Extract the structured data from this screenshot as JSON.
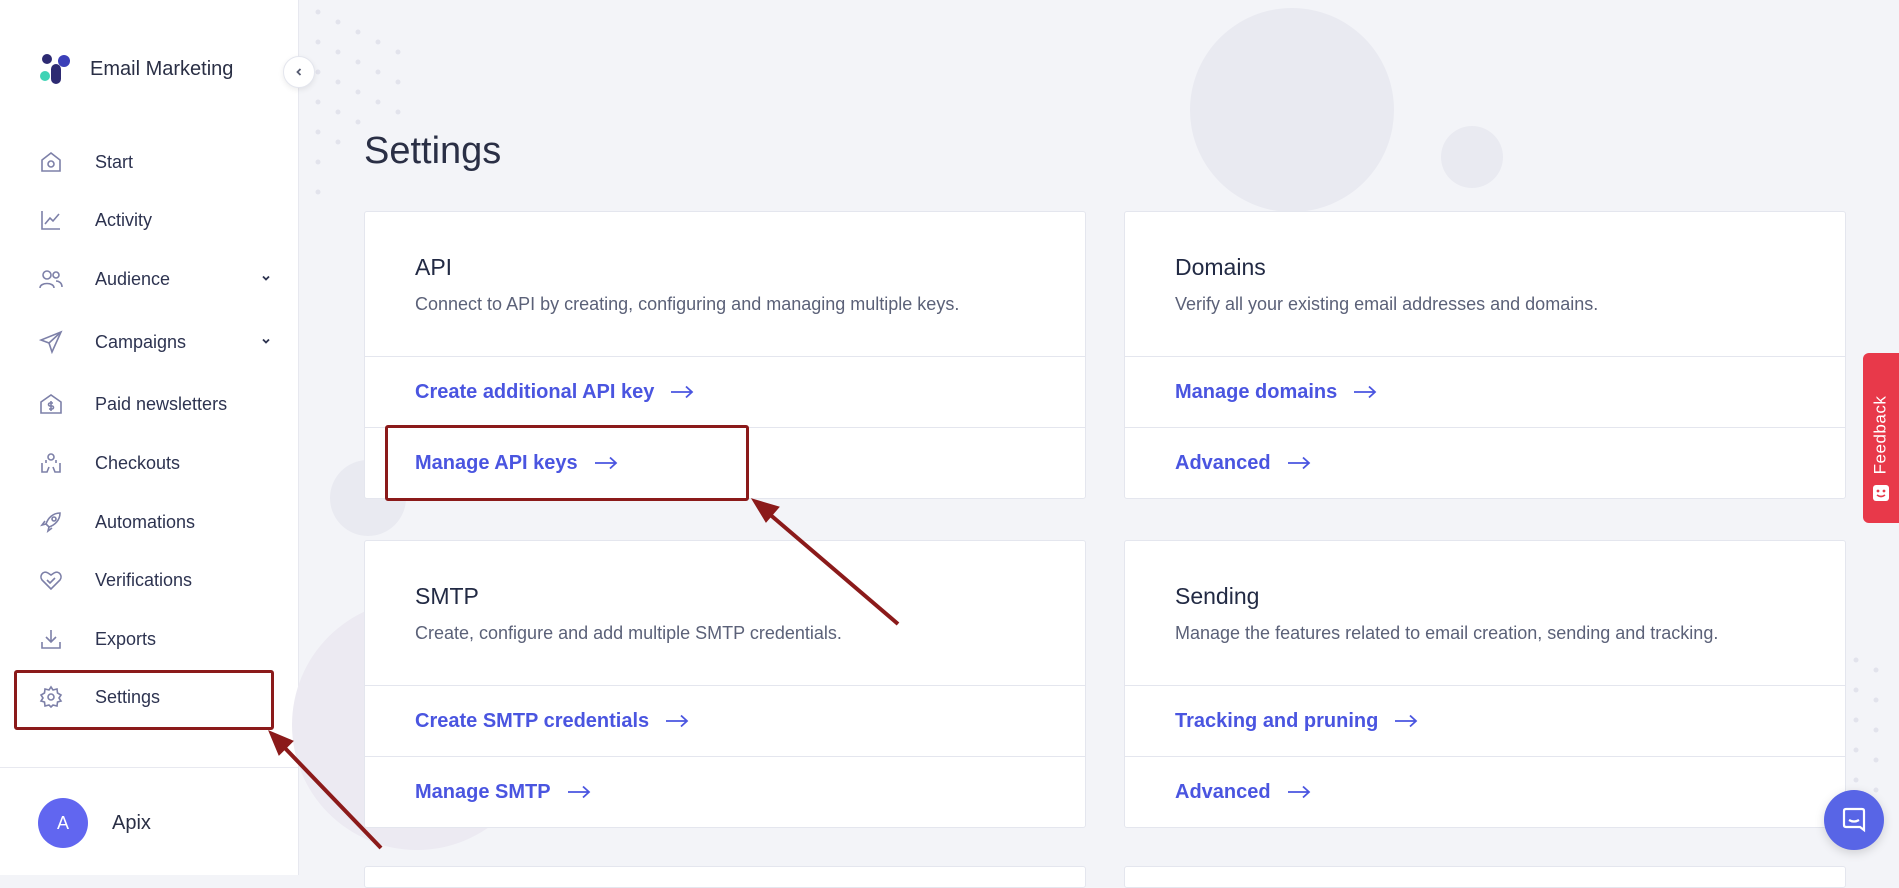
{
  "app": {
    "name": "Email Marketing"
  },
  "sidebar": {
    "items": [
      {
        "label": "Start",
        "icon": "home-icon"
      },
      {
        "label": "Activity",
        "icon": "chart-line-icon"
      },
      {
        "label": "Audience",
        "icon": "users-icon",
        "expandable": true
      },
      {
        "label": "Campaigns",
        "icon": "paper-plane-icon",
        "expandable": true
      },
      {
        "label": "Paid newsletters",
        "icon": "dollar-house-icon"
      },
      {
        "label": "Checkouts",
        "icon": "hands-coins-icon"
      },
      {
        "label": "Automations",
        "icon": "rocket-icon"
      },
      {
        "label": "Verifications",
        "icon": "heart-check-icon"
      },
      {
        "label": "Exports",
        "icon": "download-tray-icon"
      },
      {
        "label": "Settings",
        "icon": "gear-icon",
        "active": true
      }
    ],
    "user": {
      "initial": "A",
      "name": "Apix"
    }
  },
  "main": {
    "title": "Settings",
    "cards": [
      {
        "title": "API",
        "description": "Connect to API by creating, configuring and managing multiple keys.",
        "links": [
          "Create additional API key",
          "Manage API keys"
        ]
      },
      {
        "title": "Domains",
        "description": "Verify all your existing email addresses and domains.",
        "links": [
          "Manage domains",
          "Advanced"
        ]
      },
      {
        "title": "SMTP",
        "description": "Create, configure and add multiple SMTP credentials.",
        "links": [
          "Create SMTP credentials",
          "Manage SMTP"
        ]
      },
      {
        "title": "Sending",
        "description": "Manage the features related to email creation, sending and tracking.",
        "links": [
          "Tracking and pruning",
          "Advanced"
        ]
      }
    ]
  },
  "feedback": {
    "label": "Feedback"
  },
  "colors": {
    "accent": "#4a55e0",
    "annotation": "#8b1a1a",
    "feedback": "#e8394a",
    "avatar": "#6166f0"
  }
}
